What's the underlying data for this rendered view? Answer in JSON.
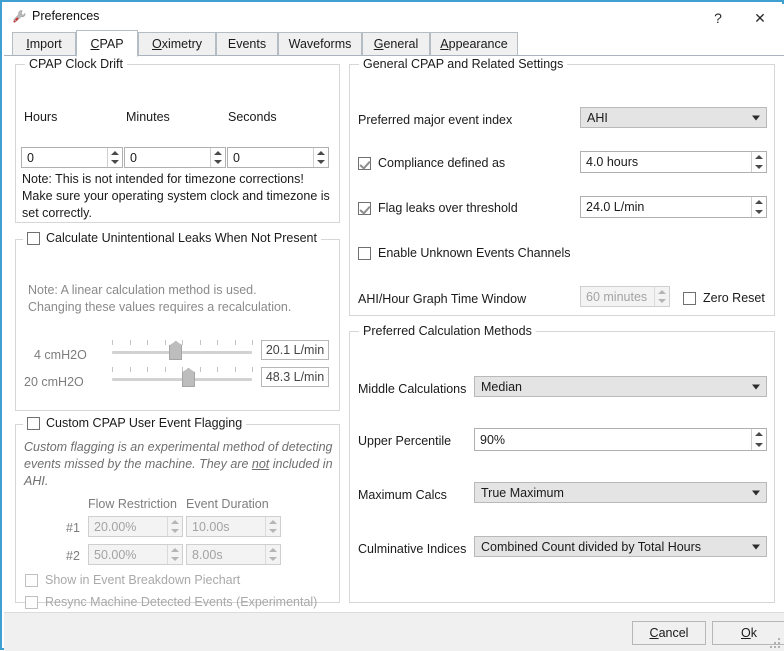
{
  "window": {
    "title": "Preferences",
    "icon": "wrench-icon",
    "help_label": "?",
    "close_label": "✕",
    "border_color": "#3f9fd0"
  },
  "tabs": [
    {
      "label": "Import",
      "mnemonic": "I",
      "active": false
    },
    {
      "label": "CPAP",
      "mnemonic": "C",
      "active": true
    },
    {
      "label": "Oximetry",
      "mnemonic": "O",
      "active": false
    },
    {
      "label": "Events",
      "mnemonic": "",
      "active": false
    },
    {
      "label": "Waveforms",
      "mnemonic": "",
      "active": false
    },
    {
      "label": "General",
      "mnemonic": "G",
      "active": false
    },
    {
      "label": "Appearance",
      "mnemonic": "A",
      "active": false
    }
  ],
  "clock_drift": {
    "title": "CPAP Clock Drift",
    "hours_label": "Hours",
    "minutes_label": "Minutes",
    "seconds_label": "Seconds",
    "hours_value": "0",
    "minutes_value": "0",
    "seconds_value": "0",
    "note": "Note: This is not intended for timezone corrections! Make sure your operating system clock and timezone is set correctly."
  },
  "unintentional_leaks": {
    "title": "Calculate Unintentional Leaks When Not Present",
    "checked": false,
    "note_line1": "Note: A linear calculation method is used.",
    "note_line2": "Changing these values requires a recalculation.",
    "row1_label": "4 cmH2O",
    "row1_value": "20.1 L/min",
    "row1_percent": 44,
    "row2_label": "20 cmH2O",
    "row2_value": "48.3 L/min",
    "row2_percent": 53
  },
  "custom_flagging": {
    "title": "Custom CPAP User Event Flagging",
    "checked": false,
    "description_a": "Custom flagging is an experimental method of detecting events missed by the machine. They are ",
    "description_not": "not",
    "description_b": " included in AHI.",
    "col1_header": "Flow Restriction",
    "col2_header": "Event Duration",
    "rows": [
      {
        "label": "#1",
        "restriction": "20.00%",
        "duration": "10.00s"
      },
      {
        "label": "#2",
        "restriction": "50.00%",
        "duration": "8.00s"
      }
    ],
    "show_piechart_label": "Show in Event Breakdown Piechart",
    "show_piechart_checked": false,
    "resync_label": "Resync Machine Detected Events (Experimental)",
    "resync_checked": false
  },
  "general_cpap": {
    "title": "General CPAP and Related Settings",
    "major_event_index_label": "Preferred major event index",
    "major_event_index_value": "AHI",
    "compliance_label": "Compliance defined as",
    "compliance_checked": true,
    "compliance_value": "4.0 hours",
    "leaks_label": "Flag leaks over threshold",
    "leaks_checked": true,
    "leaks_value": "24.0 L/min",
    "unknown_events_label": "Enable Unknown Events Channels",
    "unknown_events_checked": false,
    "ahi_window_label": "AHI/Hour Graph Time Window",
    "ahi_window_value": "60 minutes",
    "ahi_window_enabled": false,
    "zero_reset_label": "Zero Reset",
    "zero_reset_checked": false
  },
  "calc_methods": {
    "title": "Preferred Calculation Methods",
    "middle_label": "Middle Calculations",
    "middle_value": "Median",
    "upper_label": "Upper Percentile",
    "upper_value": "90%",
    "max_label": "Maximum Calcs",
    "max_value": "True Maximum",
    "cumulative_label": "Culminative Indices",
    "cumulative_value": "Combined Count divided by Total Hours"
  },
  "footer": {
    "cancel_label": "Cancel",
    "cancel_mnemonic": "C",
    "ok_label": "Ok",
    "ok_mnemonic": "O"
  }
}
